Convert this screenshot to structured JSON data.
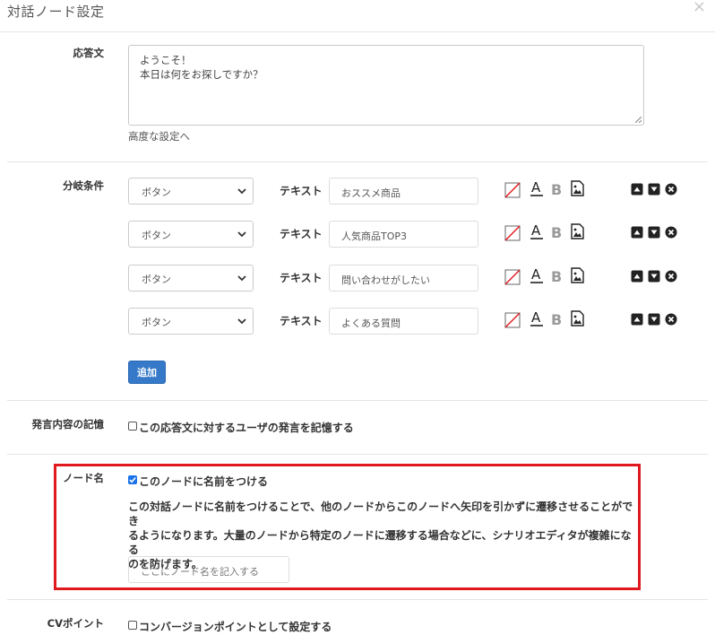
{
  "dialog": {
    "title": "対話ノード設定",
    "close_glyph": "×"
  },
  "response": {
    "label": "応答文",
    "text_line1": "ようこそ！",
    "text_line2": "本日は何をお探しですか？",
    "advanced_link": "高度な設定へ"
  },
  "branch": {
    "label": "分岐条件",
    "text_label": "テキスト",
    "rows": [
      {
        "type": "ボタン",
        "text": "おススメ商品"
      },
      {
        "type": "ボタン",
        "text": "人気商品TOP3"
      },
      {
        "type": "ボタン",
        "text": "問い合わせがしたい"
      },
      {
        "type": "ボタン",
        "text": "よくある質問"
      }
    ],
    "add_button": "追加",
    "icons": [
      "no-color-icon",
      "font-color-icon",
      "bold-icon",
      "image-icon",
      "move-up-icon",
      "move-down-icon",
      "delete-icon"
    ]
  },
  "memory": {
    "label": "発言内容の記憶",
    "checkbox_label": "この応答文に対するユーザの発言を記憶する",
    "checked": false
  },
  "node_name": {
    "label": "ノード名",
    "checkbox_label": "このノードに名前をつける",
    "checked": true,
    "description_line1": "この対話ノードに名前をつけることで、他のノードからこのノードへ矢印を引かずに遷移させることができ",
    "description_line2": "るようになります。大量のノードから特定のノードに遷移する場合などに、シナリオエディタが複雑になる",
    "description_line3": "のを防げます。",
    "placeholder": "ここにノード名を記入する"
  },
  "cv": {
    "label": "CVポイント",
    "checkbox_label": "コンバージョンポイントとして設定する",
    "checked": false
  },
  "colors": {
    "accent": "#3579c8",
    "highlight_border": "#e0191e",
    "check": "#1a73e8"
  }
}
